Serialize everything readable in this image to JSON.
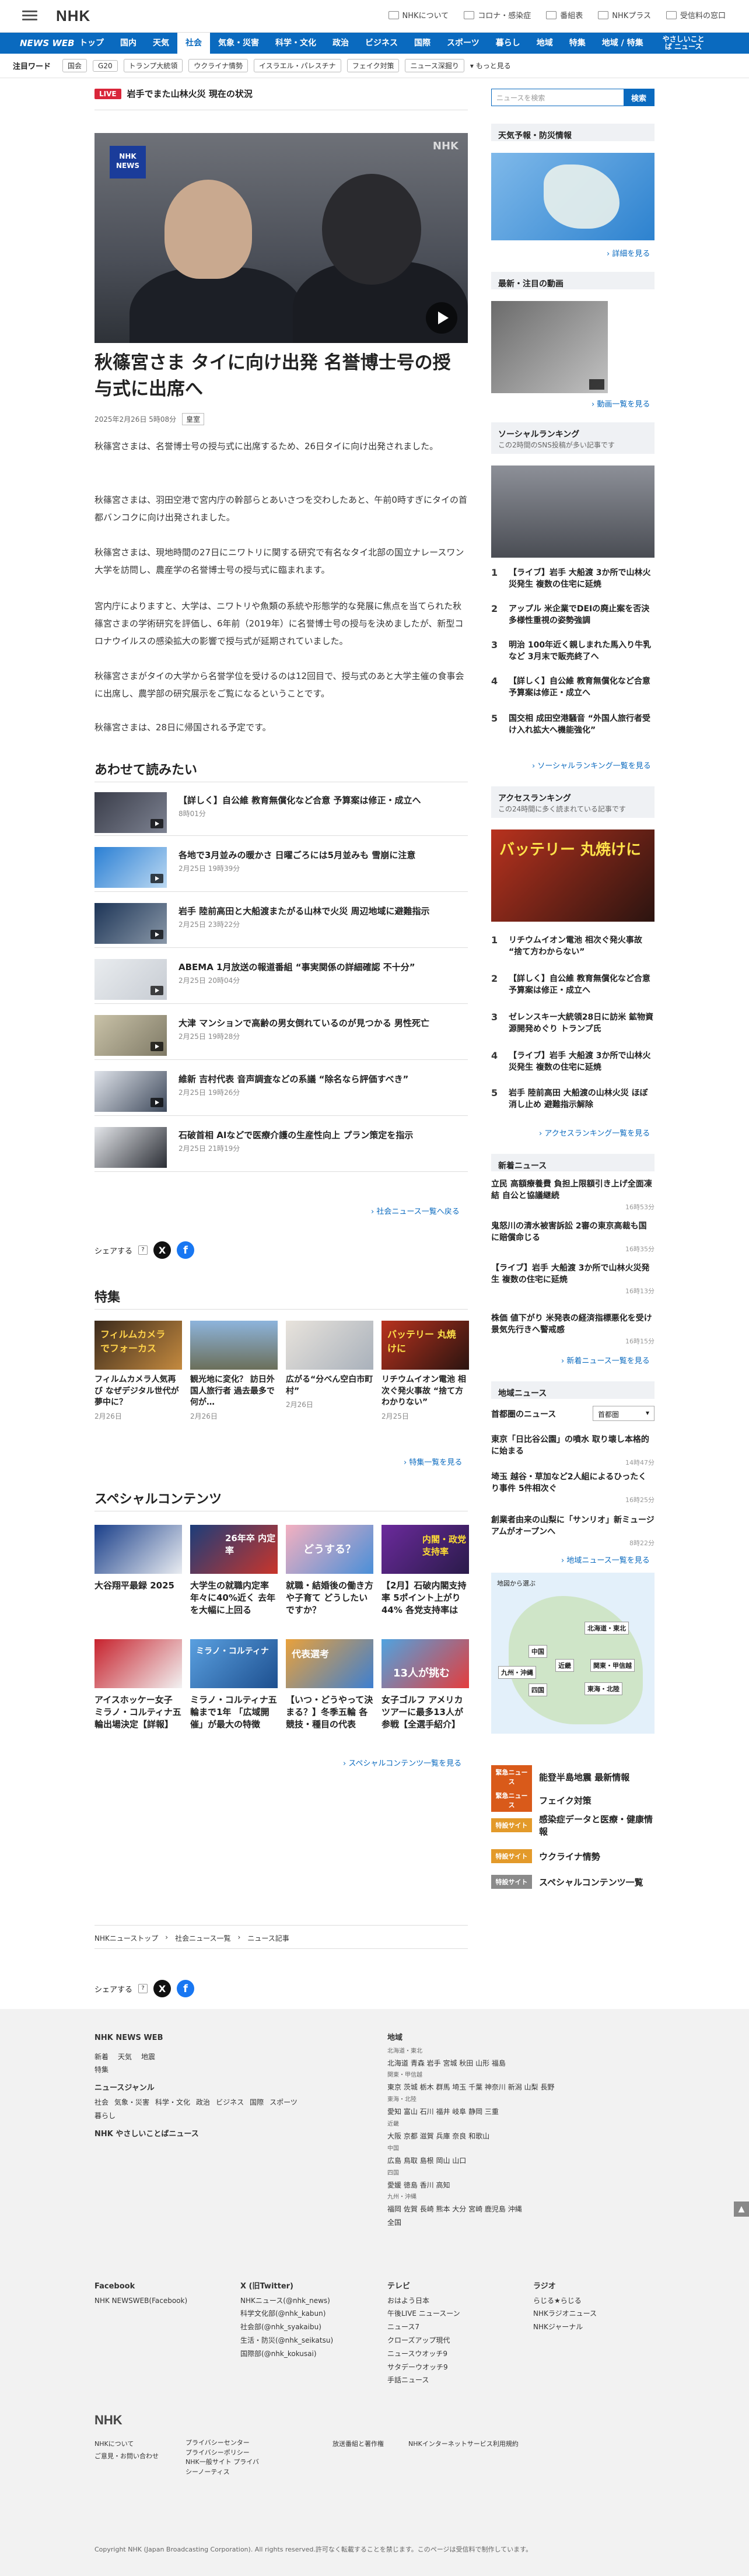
{
  "header": {
    "logo": "NHK",
    "links": [
      "NHKについて",
      "コロナ・感染症",
      "番組表",
      "NHKプラス",
      "受信料の窓口"
    ]
  },
  "nav": {
    "brand": "NEWS WEB",
    "items": [
      "トップ",
      "国内",
      "天気",
      "社会",
      "気象・災害",
      "科学・文化",
      "政治",
      "ビジネス",
      "国際",
      "スポーツ",
      "暮らし",
      "地域",
      "特集",
      "地域 / 特集",
      "やさしいことば ニュース"
    ]
  },
  "hot": {
    "label": "注目ワード",
    "tags": [
      "国会",
      "G20",
      "トランプ大統領",
      "ウクライナ情勢",
      "イスラエル・パレスチナ",
      "フェイク対策",
      "ニュース深掘り"
    ],
    "more": "▾ もっと見る"
  },
  "live": {
    "badge": "LIVE",
    "text": "岩手でまた山林火災 現在の状況"
  },
  "article": {
    "title": "秋篠宮さま タイに向け出発 名誉博士号の授与式に出席へ",
    "date": "2025年2月26日 5時08分",
    "category": "皇室",
    "p1": "秋篠宮さまは、名誉博士号の授与式に出席するため、26日タイに向け出発されました。",
    "p2": "秋篠宮さまは、羽田空港で宮内庁の幹部らとあいさつを交わしたあと、午前0時すぎにタイの首都バンコクに向け出発されました。",
    "p3": "秋篠宮さまは、現地時間の27日にニワトリに関する研究で有名なタイ北部の国立ナレースワン大学を訪問し、農産学の名誉博士号の授与式に臨まれます。",
    "p4": "宮内庁によりますと、大学は、ニワトリや魚類の系統や形態学的な発展に焦点を当てられた秋篠宮さまの学術研究を評価し、6年前（2019年）に名誉博士号の授与を決めましたが、新型コロナウイルスの感染拡大の影響で授与式が延期されていました。",
    "p5": "秋篠宮さまがタイの大学から名誉学位を受けるのは12回目で、授与式のあと大学主催の食事会に出席し、農学部の研究展示をご覧になるということです。",
    "p6": "秋篠宮さまは、28日に帰国される予定です。",
    "hero_badge": "NHK NEWS",
    "hero_wm": "NHK"
  },
  "related": {
    "title": "あわせて読みたい",
    "items": [
      {
        "title": "【詳しく】自公維 教育無償化など合意 予算案は修正・成立へ",
        "date": "8時01分"
      },
      {
        "title": "各地で3月並みの暖かさ 日曜ごろには5月並みも 雪崩に注意",
        "date": "2月25日 19時39分"
      },
      {
        "title": "岩手 陸前高田と大船渡またがる山林で火災 周辺地域に避難指示",
        "date": "2月25日 23時22分"
      },
      {
        "title": "ABEMA 1月放送の報道番組 “事実関係の詳細確認 不十分”",
        "date": "2月25日 20時04分"
      },
      {
        "title": "大津 マンションで高齢の男女倒れているのが見つかる 男性死亡",
        "date": "2月25日 19時28分"
      },
      {
        "title": "維新 吉村代表 音声調査などの系議 “除名なら評価すべき”",
        "date": "2月25日 19時26分"
      },
      {
        "title": "石破首相 AIなどで医療介護の生産性向上 プラン策定を指示",
        "date": "2月25日 21時19分"
      }
    ],
    "more": "社会ニュース一覧へ戻る"
  },
  "share": {
    "label": "シェアする"
  },
  "tokushu": {
    "title": "特集",
    "items": [
      {
        "title": "フィルムカメラ人気再び なぜデジタル世代が夢中に？",
        "date": "2月26日",
        "img": "フィルムカメラ でフォーカス"
      },
      {
        "title": "観光地に変化？ 訪日外国人旅行者 過去最多で何が…",
        "date": "2月26日",
        "img": ""
      },
      {
        "title": "広がる“分べん空白市町村”",
        "date": "2月26日",
        "img": ""
      },
      {
        "title": "リチウムイオン電池 相次ぐ発火事故 “捨て方わかりない”",
        "date": "2月25日",
        "img": "バッテリー 丸焼けに"
      }
    ],
    "more": "特集一覧を見る"
  },
  "special": {
    "title": "スペシャルコンテンツ",
    "items": [
      {
        "title": "大谷翔平最録 2025",
        "img": ""
      },
      {
        "title": "大学生の就職内定率 年々に40%近く 去年を大幅に上回る",
        "img": "26年卒 内定率"
      },
      {
        "title": "就職・結婚後の働き方や子育て どうしたいですか？",
        "img": "どうする？"
      },
      {
        "title": "【2月】石破内閣支持率 5ポイント上がり44% 各党支持率は",
        "img": "内閣・政党 支持率"
      },
      {
        "title": "アイスホッケー女子 ミラノ・コルティナ五輪出場決定【詳報】",
        "img": ""
      },
      {
        "title": "ミラノ・コルティナ五輪まで1年 「広域開催」が最大の特徴",
        "img": "ミラノ・コルティナ"
      },
      {
        "title": "【いつ・どうやって決まる？】冬季五輪 各競技・種目の代表",
        "img": "代表選考"
      },
      {
        "title": "女子ゴルフ アメリカツアーに最多13人が参戦【全選手紹介】",
        "img": "13人が挑む"
      }
    ],
    "more": "スペシャルコンテンツ一覧を見る"
  },
  "breadcrumb": [
    "NHKニューストップ",
    "社会ニュース一覧",
    "ニュース記事"
  ],
  "sidebar": {
    "search_placeholder": "ニュースを検索",
    "search_btn": "検索",
    "weather_title": "天気予報・防災情報",
    "weather_more": "詳細を見る",
    "video_title": "最新・注目の動画",
    "video_more": "動画一覧を見る",
    "social_title": "ソーシャルランキング",
    "social_sub": "この2時間のSNS投稿が多い記事です",
    "social": [
      "【ライブ】岩手 大船渡 3か所で山林火災発生 複数の住宅に延焼",
      "アップル 米企業でDEIの廃止案を否決 多様性重視の姿勢強調",
      "明治 100年近く親しまれた馬入り牛乳など 3月末で販売終了へ",
      "【詳しく】自公維 教育無償化など合意 予算案は修正・成立へ",
      "国交相 成田空港騒音 “外国人旅行者受け入れ拡大へ機能強化”"
    ],
    "social_more": "ソーシャルランキング一覧を見る",
    "access_title": "アクセスランキング",
    "access_sub": "この24時間に多く読まれている記事です",
    "access_img": "バッテリー 丸焼けに",
    "access": [
      "リチウムイオン電池 相次ぐ発火事故 “捨て方わからない”",
      "【詳しく】自公維 教育無償化など合意 予算案は修正・成立へ",
      "ゼレンスキー大統領28日に訪米 鉱物資源開発めぐり トランプ氏",
      "【ライブ】岩手 大船渡 3か所で山林火災発生 複数の住宅に延焼",
      "岩手 陸前高田 大船渡の山林火災 ほぼ消し止め 避難指示解除"
    ],
    "access_more": "アクセスランキング一覧を見る",
    "latest_title": "新着ニュース",
    "latest": [
      {
        "title": "立民 高額療養費 負担上限額引き上げ全面凍結 自公と協議継続",
        "date": "16時53分"
      },
      {
        "title": "鬼怒川の清水被害訴訟 2審の東京高裁も国に賠償命じる",
        "date": "16時35分"
      },
      {
        "title": "【ライブ】岩手 大船渡 3か所で山林火災発生 複数の住宅に延焼",
        "date": "16時13分"
      },
      {
        "title": "株価 値下がり 米発表の経済指標悪化を受け景気先行きへ警戒感",
        "date": "16時15分"
      }
    ],
    "latest_more": "新着ニュース一覧を見る",
    "local_title": "地域ニュース",
    "local_area": "首都圏のニュース",
    "local_select": "首都圏",
    "local": [
      {
        "title": "東京「日比谷公園」の噴水 取り壊し本格的に始まる",
        "date": "14時47分"
      },
      {
        "title": "埼玉 越谷・草加など2人組によるひったくり事件 5件相次ぐ",
        "date": "16時25分"
      },
      {
        "title": "創業者由来の山梨に「サンリオ」新ミュージアムがオープンへ",
        "date": "8時22分"
      }
    ],
    "local_more": "地域ニュース一覧を見る",
    "map_title": "地図から選ぶ",
    "regions": [
      "北海道・東北",
      "関東・甲信越",
      "東海・北陸",
      "近畿",
      "中国",
      "四国",
      "九州・沖縄"
    ],
    "picks": [
      {
        "label": "緊急ニュース",
        "text": "能登半島地震 最新情報"
      },
      {
        "label": "緊急ニュース",
        "text": "フェイク対策"
      },
      {
        "label": "特設サイト",
        "text": "感染症データと医療・健康情報"
      },
      {
        "label": "特設サイト",
        "text": "ウクライナ情勢"
      },
      {
        "label": "特設サイト",
        "text": "スペシャルコンテンツ一覧"
      }
    ]
  },
  "footer": {
    "brand": "NHK NEWS WEB",
    "cols1": [
      "新着",
      "天気",
      "地震",
      "特集",
      "ニュースジャンル",
      "社会",
      "気象・災害",
      "科学・文化",
      "政治",
      "ビジネス",
      "国際",
      "スポーツ",
      "暮らし",
      "NHK やさしいことばニュース"
    ],
    "region_title": "地域",
    "regions": [
      "北海道・東北",
      "北海道 青森 岩手 宮城 秋田 山形 福島",
      "関東・甲信越",
      "東京 茨城 栃木 群馬 埼玉 千葉 神奈川 新潟 山梨 長野",
      "東海・北陸",
      "愛知 富山 石川 福井 岐阜 静岡 三重",
      "近畿",
      "大阪 京都 滋賀 兵庫 奈良 和歌山",
      "中国",
      "広島 鳥取 島根 岡山 山口",
      "四国",
      "愛媛 徳島 香川 高知",
      "九州・沖縄",
      "福岡 佐賀 長崎 熊本 大分 宮崎 鹿児島 沖縄",
      "全国"
    ],
    "facebook_title": "Facebook",
    "facebook": [
      "NHK NEWSWEB(Facebook)"
    ],
    "x_title": "X (旧Twitter)",
    "x": [
      "NHKニュース(@nhk_news)",
      "科学文化部(@nhk_kabun)",
      "社会部(@nhk_syakaibu)",
      "生活・防災(@nhk_seikatsu)",
      "国際部(@nhk_kokusai)"
    ],
    "tv_title": "テレビ",
    "tv": [
      "おはよう日本",
      "午後LIVE ニュースーン",
      "ニュース7",
      "クローズアップ現代",
      "ニュースウオッチ9",
      "サタデーウオッチ9",
      "手話ニュース"
    ],
    "radio_title": "ラジオ",
    "radio": [
      "らじる★らじる",
      "NHKラジオニュース",
      "NHKジャーナル"
    ],
    "logo": "NHK",
    "bottom": [
      "NHKについて",
      "ご意見・お問い合わせ",
      "プライバシーセンター",
      "プライバシーポリシー",
      "NHK一般サイト プライバシーノーティス",
      "放送番組と著作権",
      "NHKインターネットサービス利用規約"
    ],
    "copyright": "Copyright NHK (Japan Broadcasting Corporation). All rights reserved.許可なく転載することを禁じます。このページは受信料で制作しています。"
  }
}
